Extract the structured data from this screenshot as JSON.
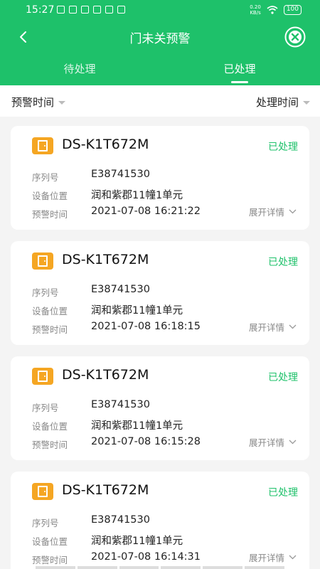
{
  "status_bar": {
    "time": "15:27",
    "net_speed_value": "0.20",
    "net_speed_unit": "KB/s",
    "battery": "100"
  },
  "title_bar": {
    "title": "门未关预警"
  },
  "tabs": [
    {
      "label": "待处理",
      "active": false
    },
    {
      "label": "已处理",
      "active": true
    }
  ],
  "filters": {
    "left": "预警时间",
    "right": "处理时间"
  },
  "labels": {
    "serial": "序列号",
    "location": "设备位置",
    "alarm_time": "预警时间",
    "expand": "展开详情"
  },
  "colors": {
    "brand": "#1ec16a",
    "icon_orange": "#f5a623"
  },
  "cards": [
    {
      "device": "DS-K1T672M",
      "status": "已处理",
      "serial": "E38741530",
      "location": "润和紫郡11幢1单元",
      "time": "2021-07-08 16:21:22"
    },
    {
      "device": "DS-K1T672M",
      "status": "已处理",
      "serial": "E38741530",
      "location": "润和紫郡11幢1单元",
      "time": "2021-07-08 16:18:15"
    },
    {
      "device": "DS-K1T672M",
      "status": "已处理",
      "serial": "E38741530",
      "location": "润和紫郡11幢1单元",
      "time": "2021-07-08 16:15:28"
    },
    {
      "device": "DS-K1T672M",
      "status": "已处理",
      "serial": "E38741530",
      "location": "润和紫郡11幢1单元",
      "time": "2021-07-08 16:14:31"
    }
  ]
}
